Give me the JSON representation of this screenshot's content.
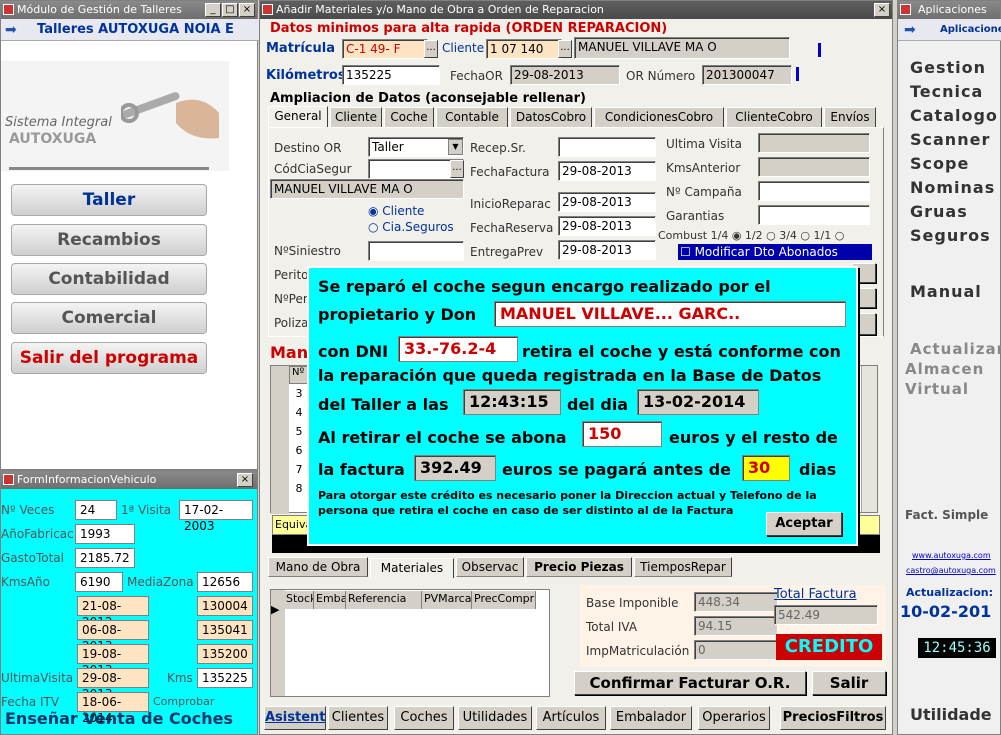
{
  "left_window": {
    "title": "Módulo de Gestión de Talleres",
    "header": "Talleres AUTOXUGA NOIA E",
    "logo_line1": "Sistema Integral",
    "logo_line2": "AUTOXUGA",
    "nav": [
      "Taller",
      "Recambios",
      "Contabilidad",
      "Comercial",
      "Salir del programa"
    ]
  },
  "vehicle_info": {
    "title": "FormInformacionVehiculo",
    "labels": {
      "veces": "Nº Veces",
      "primera_visita": "1ª Visita",
      "ano_fabric": "AñoFabricac",
      "gasto_total": "GastoTotal",
      "kms_ano": "KmsAño",
      "media_zona": "MediaZona",
      "ultima_visita": "UltimaVisita",
      "kms": "Kms",
      "fecha_itv": "Fecha ITV",
      "comprobar": "Comprobar"
    },
    "values": {
      "veces": "24",
      "primera_visita": "17-02-2003",
      "ano_fabric": "1993",
      "gasto_total": "2185.72",
      "kms_ano": "6190",
      "media_zona": "12656",
      "ultima_visita": "29-08-2013",
      "kms": "135225",
      "fecha_itv": "18-06-2014"
    },
    "history": [
      {
        "date": "21-08-2012",
        "km": "130004"
      },
      {
        "date": "06-08-2013",
        "km": "135041"
      },
      {
        "date": "19-08-2013",
        "km": "135200"
      }
    ],
    "footer": "Enseñar Venta de Coches"
  },
  "main_window": {
    "title": "Añadir Materiales y/o Mano de Obra a Orden de Reparacion",
    "section_title": "Datos minimos para alta rapida (ORDEN REPARACION)",
    "matricula_label": "Matrícula",
    "matricula": "C-1  49-  F",
    "cliente_label": "Cliente",
    "cliente_code": "1  07  140",
    "cliente_name": "MANUEL VILLAVE       MA    O",
    "km_label": "Kilómetros",
    "km": "135225",
    "fechaor_label": "FechaOR",
    "fechaor": "29-08-2013",
    "or_num_label": "OR Número",
    "or_num": "201300047",
    "ampliacion": "Ampliacion de Datos (aconsejable rellenar)",
    "tabs": [
      "General",
      "Cliente",
      "Coche",
      "Contable",
      "DatosCobro",
      "CondicionesCobro",
      "ClienteCobro",
      "Envíos"
    ],
    "general": {
      "destino_label": "Destino OR",
      "destino": "Taller",
      "codcia_label": "CódCiaSegur",
      "owner": "MANUEL VILLAVE         MA    O",
      "radio_cliente": "Cliente",
      "radio_cia": "Cia.Seguros",
      "siniestro": "NºSiniestro",
      "perito": "Perito",
      "nper": "NºPer",
      "poliza": "Poliza",
      "recep_label": "Recep.Sr.",
      "fechafactura_label": "FechaFactura",
      "fechafactura": "29-08-2013",
      "inicio_label": "InicioReparac",
      "inicio": "29-08-2013",
      "fechareserva_label": "FechaReserva",
      "fechareserva": "29-08-2013",
      "entrega_label": "EntregaPrev",
      "entrega": "29-08-2013",
      "ultima_visita": "Ultima Visita",
      "kms_anterior": "KmsAnterior",
      "campana": "Nº Campaña",
      "garantias": "Garantias",
      "combust_label": "Combust",
      "combust_opts": [
        "1/4",
        "1/2",
        "3/4",
        "1/1"
      ],
      "modificar": "Modificar Dto Abonados"
    },
    "mano_label": "Man",
    "grid_rows": [
      "3",
      "4",
      "5",
      "6",
      "7",
      "8"
    ],
    "grid_header": "Nº",
    "equiv": "Equiva",
    "lower_tabs": [
      "Mano de Obra",
      "Materiales",
      "Observac",
      "Precio Piezas",
      "TiemposRepar"
    ],
    "mat_columns": [
      "Stock",
      "Emba",
      "Referencia",
      "PVMarca",
      "PrecCompr"
    ],
    "totals": {
      "base_label": "Base Imponible",
      "base": "448.34",
      "iva_label": "Total IVA",
      "iva": "94.15",
      "impm_label": "ImpMatriculación",
      "impm": "0",
      "total_label": "Total Factura",
      "total": "542.49",
      "credito": "CREDITO"
    },
    "confirm_btn": "Confirmar Facturar O.R.",
    "salir_btn": "Salir",
    "bottom_tabs": [
      "Asistent",
      "Clientes",
      "Coches",
      "Utilidades",
      "Artículos",
      "Embalador",
      "Operarios",
      "PreciosFiltros"
    ]
  },
  "dialog": {
    "l1": "Se reparó el coche segun encargo realizado por el",
    "l2": "propietario y Don",
    "name": "MANUEL VILLAVE... GARC..",
    "l3a": "con DNI",
    "dni": "33.-76.2-4",
    "l3b": "retira el coche y está conforme con",
    "l4": "la reparación que queda registrada en la Base de Datos",
    "l5a": "del Taller a las",
    "time": "12:43:15",
    "l5b": "del dia",
    "date": "13-02-2014",
    "l6a": "Al retirar el coche se abona",
    "abona": "150",
    "l6b": "euros y el resto de",
    "l7a": "la factura",
    "resto": "392.49",
    "l7b": "euros se pagará antes de",
    "dias": "30",
    "l7c": "dias",
    "note1": "Para otorgar este crédito es necesario poner la Direccion actual y Telefono de la",
    "note2": "persona que retira el coche en caso de ser distinto al de la Factura",
    "accept": "Aceptar"
  },
  "right_window": {
    "title": "Aplicaciones",
    "header": "Aplicaciones",
    "menu": [
      "Gestion",
      "Tecnica",
      "Catalogo",
      "Scanner",
      "Scope",
      "Nominas",
      "Gruas",
      "Seguros"
    ],
    "manual": "Manual",
    "actualizar": [
      "Actualizar",
      "Almacen",
      "Virtual"
    ],
    "fact_simple": "Fact. Simple",
    "web": "www.autoxuga.com",
    "email": "castro@autoxuga.com",
    "actualizacion": "Actualizacion:",
    "act_date": "10-02-201",
    "clock": "12:45:36",
    "utilidades": "Utilidade"
  }
}
